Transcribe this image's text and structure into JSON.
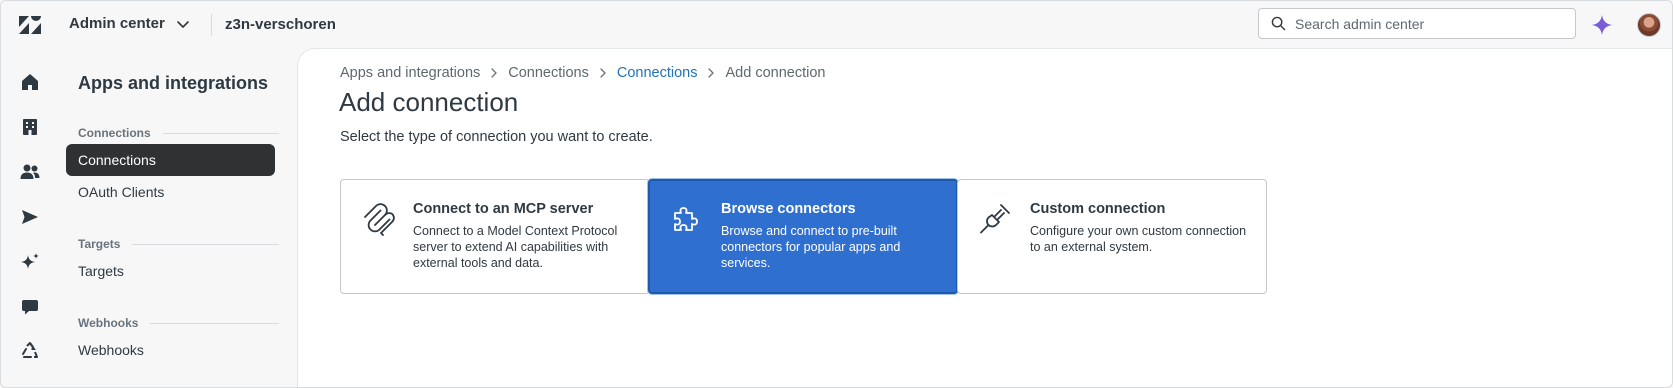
{
  "topbar": {
    "product_label": "Admin center",
    "account_name": "z3n-verschoren",
    "search_placeholder": "Search admin center",
    "icons": [
      "zendesk-logo-icon",
      "chevron-down-icon",
      "search-icon",
      "sparkle-icon",
      "avatar"
    ]
  },
  "rail": {
    "icons": [
      "home-icon",
      "building-icon",
      "people-icon",
      "send-icon",
      "ai-sparkle-icon",
      "chat-icon",
      "recycle-icon"
    ]
  },
  "subnav": {
    "title": "Apps and integrations",
    "groups": [
      {
        "label": "Connections",
        "items": [
          {
            "label": "Connections",
            "active": true
          },
          {
            "label": "OAuth Clients",
            "active": false
          }
        ]
      },
      {
        "label": "Targets",
        "items": [
          {
            "label": "Targets",
            "active": false
          }
        ]
      },
      {
        "label": "Webhooks",
        "items": [
          {
            "label": "Webhooks",
            "active": false
          }
        ]
      }
    ]
  },
  "main": {
    "breadcrumb": [
      "Apps and integrations",
      "Connections",
      "Connections",
      "Add connection"
    ],
    "title": "Add connection",
    "subtitle": "Select the type of connection you want to create.",
    "cards": [
      {
        "title": "Connect to an MCP server",
        "description": "Connect to a Model Context Protocol server to extend AI capabilities with external tools and data.",
        "icon": "mcp-icon",
        "selected": false
      },
      {
        "title": "Browse connectors",
        "description": "Browse and connect to pre-built connectors for popular apps and services.",
        "icon": "puzzle-icon",
        "selected": true
      },
      {
        "title": "Custom connection",
        "description": "Configure your own custom connection to an external system.",
        "icon": "plug-icon",
        "selected": false
      }
    ]
  },
  "colors": {
    "accent_blue": "#2f6fd0",
    "link_blue": "#1f73b7",
    "active_nav_bg": "#2f3133",
    "sparkle_purple": "#7b5cd6"
  }
}
